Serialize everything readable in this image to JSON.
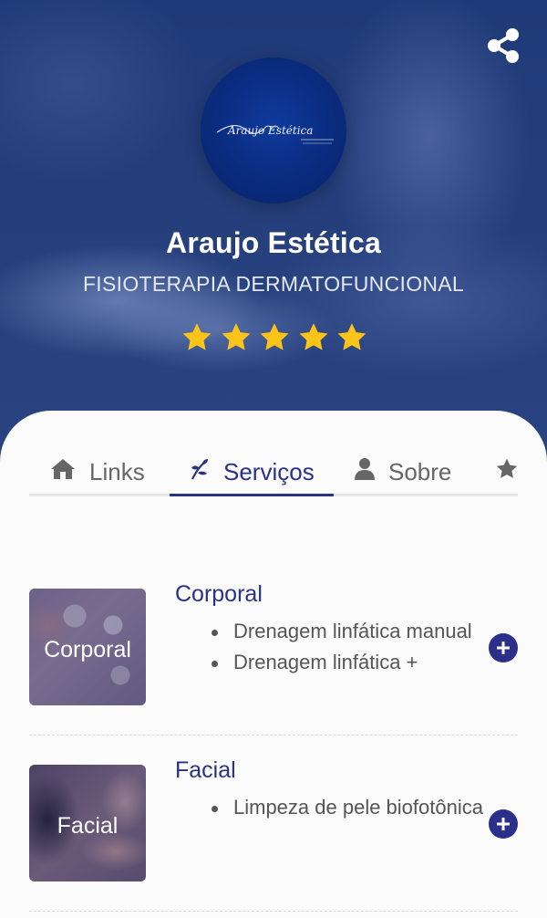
{
  "profile": {
    "name": "Araujo Estética",
    "subtitle": "FISIOTERAPIA DERMATOFUNCIONAL",
    "logo_text": "Araujo Estética",
    "rating": 5,
    "rating_max": 5
  },
  "tabs": [
    {
      "label": "Links",
      "icon": "home-icon",
      "active": false
    },
    {
      "label": "Serviços",
      "icon": "leaf-icon",
      "active": true
    },
    {
      "label": "Sobre",
      "icon": "user-icon",
      "active": false
    },
    {
      "label": "",
      "icon": "star-icon",
      "active": false
    }
  ],
  "services": [
    {
      "title": "Corporal",
      "image_label": "Corporal",
      "items": [
        "Drenagem linfática manual",
        "Drenagem linfática +"
      ]
    },
    {
      "title": "Facial",
      "image_label": "Facial",
      "items": [
        "Limpeza de pele biofotônica"
      ]
    }
  ],
  "colors": {
    "accent": "#2a3284",
    "hero": "#253f7c",
    "star": "#fcc419",
    "text_muted": "#666666"
  },
  "icons": {
    "share": "share-icon",
    "expand": "plus-circle-icon"
  }
}
